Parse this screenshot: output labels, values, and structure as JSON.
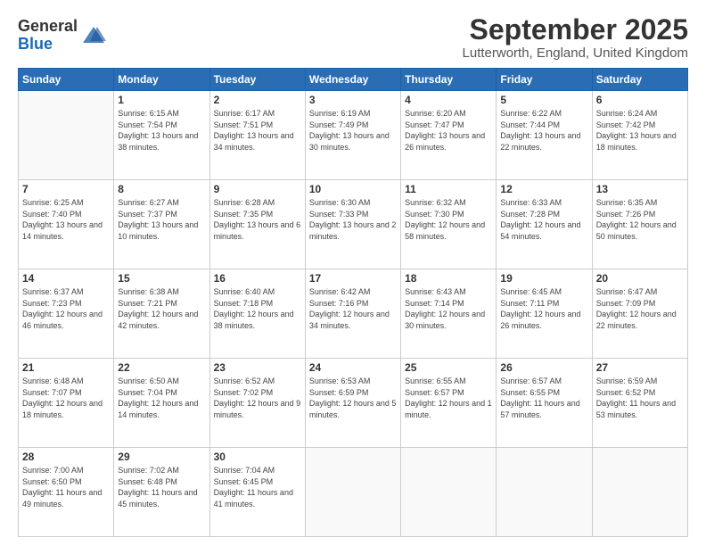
{
  "logo": {
    "general": "General",
    "blue": "Blue"
  },
  "header": {
    "month": "September 2025",
    "location": "Lutterworth, England, United Kingdom"
  },
  "days": [
    "Sunday",
    "Monday",
    "Tuesday",
    "Wednesday",
    "Thursday",
    "Friday",
    "Saturday"
  ],
  "weeks": [
    [
      {
        "num": "",
        "sunrise": "",
        "sunset": "",
        "daylight": ""
      },
      {
        "num": "1",
        "sunrise": "Sunrise: 6:15 AM",
        "sunset": "Sunset: 7:54 PM",
        "daylight": "Daylight: 13 hours and 38 minutes."
      },
      {
        "num": "2",
        "sunrise": "Sunrise: 6:17 AM",
        "sunset": "Sunset: 7:51 PM",
        "daylight": "Daylight: 13 hours and 34 minutes."
      },
      {
        "num": "3",
        "sunrise": "Sunrise: 6:19 AM",
        "sunset": "Sunset: 7:49 PM",
        "daylight": "Daylight: 13 hours and 30 minutes."
      },
      {
        "num": "4",
        "sunrise": "Sunrise: 6:20 AM",
        "sunset": "Sunset: 7:47 PM",
        "daylight": "Daylight: 13 hours and 26 minutes."
      },
      {
        "num": "5",
        "sunrise": "Sunrise: 6:22 AM",
        "sunset": "Sunset: 7:44 PM",
        "daylight": "Daylight: 13 hours and 22 minutes."
      },
      {
        "num": "6",
        "sunrise": "Sunrise: 6:24 AM",
        "sunset": "Sunset: 7:42 PM",
        "daylight": "Daylight: 13 hours and 18 minutes."
      }
    ],
    [
      {
        "num": "7",
        "sunrise": "Sunrise: 6:25 AM",
        "sunset": "Sunset: 7:40 PM",
        "daylight": "Daylight: 13 hours and 14 minutes."
      },
      {
        "num": "8",
        "sunrise": "Sunrise: 6:27 AM",
        "sunset": "Sunset: 7:37 PM",
        "daylight": "Daylight: 13 hours and 10 minutes."
      },
      {
        "num": "9",
        "sunrise": "Sunrise: 6:28 AM",
        "sunset": "Sunset: 7:35 PM",
        "daylight": "Daylight: 13 hours and 6 minutes."
      },
      {
        "num": "10",
        "sunrise": "Sunrise: 6:30 AM",
        "sunset": "Sunset: 7:33 PM",
        "daylight": "Daylight: 13 hours and 2 minutes."
      },
      {
        "num": "11",
        "sunrise": "Sunrise: 6:32 AM",
        "sunset": "Sunset: 7:30 PM",
        "daylight": "Daylight: 12 hours and 58 minutes."
      },
      {
        "num": "12",
        "sunrise": "Sunrise: 6:33 AM",
        "sunset": "Sunset: 7:28 PM",
        "daylight": "Daylight: 12 hours and 54 minutes."
      },
      {
        "num": "13",
        "sunrise": "Sunrise: 6:35 AM",
        "sunset": "Sunset: 7:26 PM",
        "daylight": "Daylight: 12 hours and 50 minutes."
      }
    ],
    [
      {
        "num": "14",
        "sunrise": "Sunrise: 6:37 AM",
        "sunset": "Sunset: 7:23 PM",
        "daylight": "Daylight: 12 hours and 46 minutes."
      },
      {
        "num": "15",
        "sunrise": "Sunrise: 6:38 AM",
        "sunset": "Sunset: 7:21 PM",
        "daylight": "Daylight: 12 hours and 42 minutes."
      },
      {
        "num": "16",
        "sunrise": "Sunrise: 6:40 AM",
        "sunset": "Sunset: 7:18 PM",
        "daylight": "Daylight: 12 hours and 38 minutes."
      },
      {
        "num": "17",
        "sunrise": "Sunrise: 6:42 AM",
        "sunset": "Sunset: 7:16 PM",
        "daylight": "Daylight: 12 hours and 34 minutes."
      },
      {
        "num": "18",
        "sunrise": "Sunrise: 6:43 AM",
        "sunset": "Sunset: 7:14 PM",
        "daylight": "Daylight: 12 hours and 30 minutes."
      },
      {
        "num": "19",
        "sunrise": "Sunrise: 6:45 AM",
        "sunset": "Sunset: 7:11 PM",
        "daylight": "Daylight: 12 hours and 26 minutes."
      },
      {
        "num": "20",
        "sunrise": "Sunrise: 6:47 AM",
        "sunset": "Sunset: 7:09 PM",
        "daylight": "Daylight: 12 hours and 22 minutes."
      }
    ],
    [
      {
        "num": "21",
        "sunrise": "Sunrise: 6:48 AM",
        "sunset": "Sunset: 7:07 PM",
        "daylight": "Daylight: 12 hours and 18 minutes."
      },
      {
        "num": "22",
        "sunrise": "Sunrise: 6:50 AM",
        "sunset": "Sunset: 7:04 PM",
        "daylight": "Daylight: 12 hours and 14 minutes."
      },
      {
        "num": "23",
        "sunrise": "Sunrise: 6:52 AM",
        "sunset": "Sunset: 7:02 PM",
        "daylight": "Daylight: 12 hours and 9 minutes."
      },
      {
        "num": "24",
        "sunrise": "Sunrise: 6:53 AM",
        "sunset": "Sunset: 6:59 PM",
        "daylight": "Daylight: 12 hours and 5 minutes."
      },
      {
        "num": "25",
        "sunrise": "Sunrise: 6:55 AM",
        "sunset": "Sunset: 6:57 PM",
        "daylight": "Daylight: 12 hours and 1 minute."
      },
      {
        "num": "26",
        "sunrise": "Sunrise: 6:57 AM",
        "sunset": "Sunset: 6:55 PM",
        "daylight": "Daylight: 11 hours and 57 minutes."
      },
      {
        "num": "27",
        "sunrise": "Sunrise: 6:59 AM",
        "sunset": "Sunset: 6:52 PM",
        "daylight": "Daylight: 11 hours and 53 minutes."
      }
    ],
    [
      {
        "num": "28",
        "sunrise": "Sunrise: 7:00 AM",
        "sunset": "Sunset: 6:50 PM",
        "daylight": "Daylight: 11 hours and 49 minutes."
      },
      {
        "num": "29",
        "sunrise": "Sunrise: 7:02 AM",
        "sunset": "Sunset: 6:48 PM",
        "daylight": "Daylight: 11 hours and 45 minutes."
      },
      {
        "num": "30",
        "sunrise": "Sunrise: 7:04 AM",
        "sunset": "Sunset: 6:45 PM",
        "daylight": "Daylight: 11 hours and 41 minutes."
      },
      {
        "num": "",
        "sunrise": "",
        "sunset": "",
        "daylight": ""
      },
      {
        "num": "",
        "sunrise": "",
        "sunset": "",
        "daylight": ""
      },
      {
        "num": "",
        "sunrise": "",
        "sunset": "",
        "daylight": ""
      },
      {
        "num": "",
        "sunrise": "",
        "sunset": "",
        "daylight": ""
      }
    ]
  ]
}
